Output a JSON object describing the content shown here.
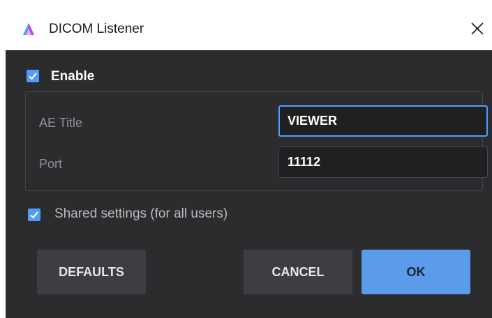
{
  "window": {
    "title": "DICOM Listener"
  },
  "enable": {
    "label": "Enable",
    "checked": true
  },
  "fields": {
    "ae_title": {
      "label": "AE Title",
      "value": "VIEWER"
    },
    "port": {
      "label": "Port",
      "value": "11112"
    }
  },
  "shared": {
    "label": "Shared settings (for all users)",
    "checked": true
  },
  "buttons": {
    "defaults": "DEFAULTS",
    "cancel": "CANCEL",
    "ok": "OK"
  },
  "colors": {
    "accent": "#4f9bff",
    "background": "#2b2c2e",
    "ok_button": "#5b9bea"
  }
}
